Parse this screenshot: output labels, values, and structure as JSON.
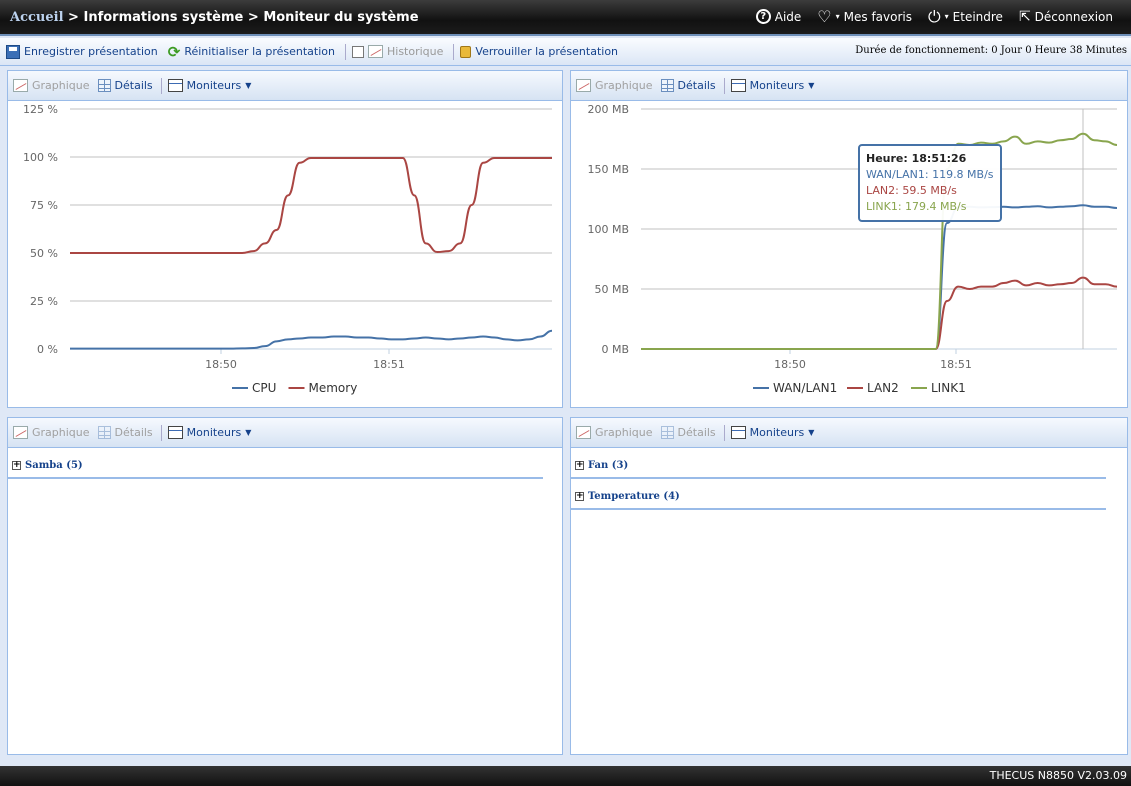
{
  "breadcrumb": {
    "home": "Accueil",
    "sep": " > ",
    "level1": "Informations système",
    "level2": "Moniteur du système"
  },
  "topnav": {
    "help": "Aide",
    "favorites": "Mes favoris",
    "shutdown": "Eteindre",
    "logout": "Déconnexion"
  },
  "toolbar": {
    "save": "Enregistrer présentation",
    "reset": "Réinitialiser la présentation",
    "history": "Historique",
    "lock": "Verrouiller la présentation",
    "uptime": "Durée de fonctionnement:  0 Jour 0 Heure 38 Minutes"
  },
  "panel_tools": {
    "graph": "Graphique",
    "details": "Détails",
    "monitors": "Moniteurs"
  },
  "panels": {
    "bottom_left": {
      "items": [
        "Samba (5)"
      ]
    },
    "bottom_right": {
      "items": [
        "Fan (3)",
        "Temperature (4)"
      ]
    }
  },
  "chart_data": [
    {
      "type": "line",
      "x_ticks": [
        "18:50",
        "18:51"
      ],
      "y_ticks": [
        "125 %",
        "100 %",
        "75 %",
        "50 %",
        "25 %",
        "0 %"
      ],
      "ylim": [
        0,
        125
      ],
      "x": [
        0,
        2,
        4,
        6,
        8,
        10,
        12,
        14,
        16,
        18,
        20,
        22,
        24,
        26,
        28,
        30,
        32,
        34,
        36,
        38,
        40,
        42,
        44,
        46,
        48,
        50,
        52,
        54,
        56,
        58,
        60,
        62,
        64,
        66,
        68,
        70,
        72,
        74,
        76,
        78,
        80,
        82,
        84
      ],
      "series": [
        {
          "name": "CPU",
          "color": "#4572a7",
          "values": [
            0.2,
            0.2,
            0.2,
            0.2,
            0.2,
            0.2,
            0.2,
            0.2,
            0.2,
            0.2,
            0.2,
            0.2,
            0.2,
            0.2,
            0.2,
            0.3,
            0.5,
            1.5,
            4,
            5,
            5.5,
            6,
            6,
            6.5,
            6.5,
            6,
            6,
            5.5,
            5,
            5,
            5.5,
            6,
            5.5,
            5,
            5.5,
            6,
            6.5,
            6,
            5,
            4.5,
            5,
            6.5,
            9.5
          ]
        },
        {
          "name": "Memory",
          "color": "#aa4643",
          "values": [
            50,
            50,
            50,
            50,
            50,
            50,
            50,
            50,
            50,
            50,
            50,
            50,
            50,
            50,
            50,
            50,
            51,
            55,
            62,
            80,
            97,
            99.5,
            99.5,
            99.5,
            99.5,
            99.5,
            99.5,
            99.5,
            99.5,
            99.5,
            80,
            55,
            50.5,
            51,
            55,
            75,
            97,
            99.5,
            99.5,
            99.5,
            99.5,
            99.5,
            99.5
          ]
        }
      ]
    },
    {
      "type": "line",
      "x_ticks": [
        "18:50",
        "18:51"
      ],
      "y_ticks": [
        "200 MB",
        "150 MB",
        "100 MB",
        "50 MB",
        "0 MB"
      ],
      "ylim": [
        0,
        200
      ],
      "x": [
        0,
        2,
        4,
        6,
        8,
        10,
        12,
        14,
        16,
        18,
        20,
        22,
        24,
        26,
        28,
        30,
        32,
        34,
        36,
        38,
        40,
        42,
        44,
        46,
        48,
        50,
        52,
        54,
        56,
        58,
        60,
        62,
        64,
        66,
        68,
        70,
        72,
        74,
        76,
        78,
        80,
        82,
        84
      ],
      "series": [
        {
          "name": "WAN/LAN1",
          "color": "#4572a7",
          "values": [
            0,
            0,
            0,
            0,
            0,
            0,
            0,
            0,
            0,
            0,
            0,
            0,
            0,
            0,
            0,
            0,
            0,
            0,
            0,
            0,
            0,
            0,
            0,
            0,
            0,
            0,
            0,
            105,
            118,
            118.5,
            118,
            118.2,
            118.5,
            118,
            118.5,
            119,
            118,
            118.5,
            119,
            119.8,
            118.5,
            118.5,
            117.5
          ]
        },
        {
          "name": "LAN2",
          "color": "#aa4643",
          "values": [
            0,
            0,
            0,
            0,
            0,
            0,
            0,
            0,
            0,
            0,
            0,
            0,
            0,
            0,
            0,
            0,
            0,
            0,
            0,
            0,
            0,
            0,
            0,
            0,
            0,
            0,
            0,
            40,
            52,
            50,
            52,
            52,
            55,
            57,
            53,
            55,
            53,
            54,
            55,
            59.5,
            54,
            54,
            52
          ]
        },
        {
          "name": "LINK1",
          "color": "#89a54e",
          "values": [
            0,
            0,
            0,
            0,
            0,
            0,
            0,
            0,
            0,
            0,
            0,
            0,
            0,
            0,
            0,
            0,
            0,
            0,
            0,
            0,
            0,
            0,
            0,
            0,
            0,
            0,
            0,
            150,
            171,
            170,
            172,
            171,
            173,
            177,
            171,
            173,
            172,
            174,
            175,
            179.4,
            174,
            173,
            170
          ]
        }
      ],
      "tooltip": {
        "title": "Heure: 18:51:26",
        "lines": [
          "WAN/LAN1: 119.8 MB/s",
          "LAN2: 59.5 MB/s",
          "LINK1: 179.4 MB/s"
        ]
      }
    }
  ],
  "footer": "THECUS N8850 V2.03.09"
}
